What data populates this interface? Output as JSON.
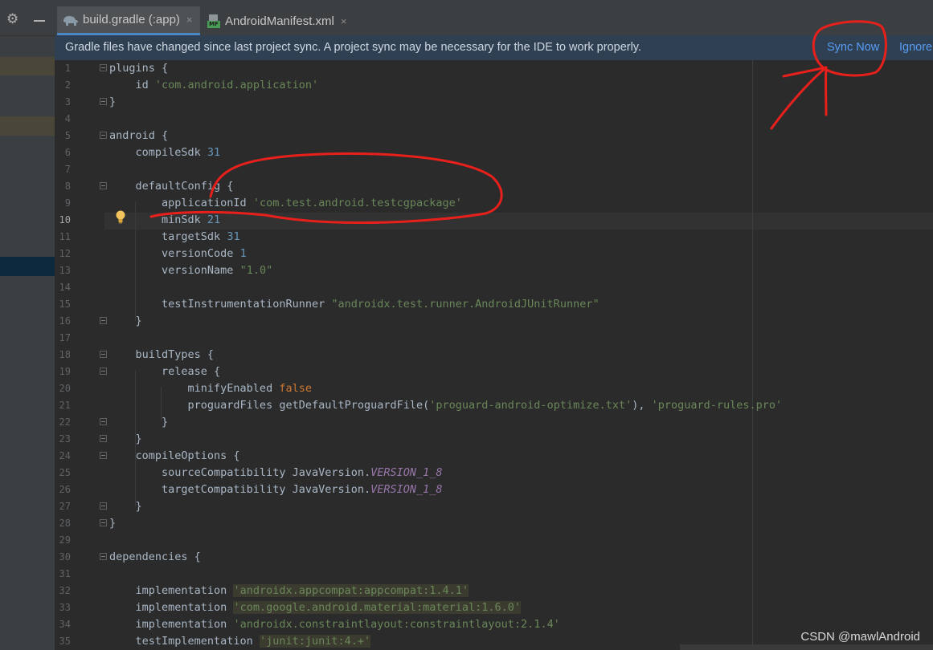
{
  "toolbar": {
    "gear_icon": "gear-icon",
    "minimize_icon": "minus-icon"
  },
  "tabs": [
    {
      "label": "build.gradle (:app)",
      "icon": "gradle-elephant-icon",
      "close": "×",
      "active": true
    },
    {
      "label": "AndroidManifest.xml",
      "icon": "manifest-file-icon",
      "icon_text": "MF",
      "close": "×",
      "active": false
    }
  ],
  "banner": {
    "message": "Gradle files have changed since last project sync. A project sync may be necessary for the IDE to work properly.",
    "sync_now": "Sync Now",
    "ignore": "Ignore"
  },
  "editor": {
    "current_line": 10,
    "lines": [
      {
        "n": "1",
        "tokens": [
          [
            "plugins {",
            "p"
          ]
        ]
      },
      {
        "n": "2",
        "tokens": [
          [
            "    id ",
            "p"
          ],
          [
            "'com.android.application'",
            "s"
          ]
        ]
      },
      {
        "n": "3",
        "tokens": [
          [
            "}",
            "p"
          ]
        ]
      },
      {
        "n": "4",
        "tokens": []
      },
      {
        "n": "5",
        "tokens": [
          [
            "android {",
            "p"
          ]
        ]
      },
      {
        "n": "6",
        "tokens": [
          [
            "    compileSdk ",
            "p"
          ],
          [
            "31",
            "n"
          ]
        ]
      },
      {
        "n": "7",
        "tokens": []
      },
      {
        "n": "8",
        "tokens": [
          [
            "    defaultConfig {",
            "p"
          ]
        ]
      },
      {
        "n": "9",
        "tokens": [
          [
            "        applicationId ",
            "p"
          ],
          [
            "'com.test.android.testcgpackage'",
            "s"
          ]
        ]
      },
      {
        "n": "10",
        "tokens": [
          [
            "        minSdk ",
            "p"
          ],
          [
            "21",
            "n"
          ]
        ]
      },
      {
        "n": "11",
        "tokens": [
          [
            "        targetSdk ",
            "p"
          ],
          [
            "31",
            "n"
          ]
        ]
      },
      {
        "n": "12",
        "tokens": [
          [
            "        versionCode ",
            "p"
          ],
          [
            "1",
            "n"
          ]
        ]
      },
      {
        "n": "13",
        "tokens": [
          [
            "        versionName ",
            "p"
          ],
          [
            "\"1.0\"",
            "s"
          ]
        ]
      },
      {
        "n": "14",
        "tokens": []
      },
      {
        "n": "15",
        "tokens": [
          [
            "        testInstrumentationRunner ",
            "p"
          ],
          [
            "\"androidx.test.runner.AndroidJUnitRunner\"",
            "s"
          ]
        ]
      },
      {
        "n": "16",
        "tokens": [
          [
            "    }",
            "p"
          ]
        ]
      },
      {
        "n": "17",
        "tokens": []
      },
      {
        "n": "18",
        "tokens": [
          [
            "    buildTypes {",
            "p"
          ]
        ]
      },
      {
        "n": "19",
        "tokens": [
          [
            "        release {",
            "p"
          ]
        ]
      },
      {
        "n": "20",
        "tokens": [
          [
            "            minifyEnabled ",
            "p"
          ],
          [
            "false",
            "k"
          ]
        ]
      },
      {
        "n": "21",
        "tokens": [
          [
            "            proguardFiles getDefaultProguardFile(",
            "p"
          ],
          [
            "'proguard-android-optimize.txt'",
            "s"
          ],
          [
            "), ",
            "p"
          ],
          [
            "'proguard-rules.pro'",
            "s"
          ]
        ]
      },
      {
        "n": "22",
        "tokens": [
          [
            "        }",
            "p"
          ]
        ]
      },
      {
        "n": "23",
        "tokens": [
          [
            "    }",
            "p"
          ]
        ]
      },
      {
        "n": "24",
        "tokens": [
          [
            "    compileOptions {",
            "p"
          ]
        ]
      },
      {
        "n": "25",
        "tokens": [
          [
            "        sourceCompatibility JavaVersion.",
            "p"
          ],
          [
            "VERSION_1_8",
            "c"
          ]
        ]
      },
      {
        "n": "26",
        "tokens": [
          [
            "        targetCompatibility JavaVersion.",
            "p"
          ],
          [
            "VERSION_1_8",
            "c"
          ]
        ]
      },
      {
        "n": "27",
        "tokens": [
          [
            "    }",
            "p"
          ]
        ]
      },
      {
        "n": "28",
        "tokens": [
          [
            "}",
            "p"
          ]
        ]
      },
      {
        "n": "29",
        "tokens": []
      },
      {
        "n": "30",
        "tokens": [
          [
            "dependencies {",
            "p"
          ]
        ]
      },
      {
        "n": "31",
        "tokens": []
      },
      {
        "n": "32",
        "tokens": [
          [
            "    implementation ",
            "p"
          ],
          [
            "'androidx.appcompat:appcompat:1.4.1'",
            "sh"
          ]
        ]
      },
      {
        "n": "33",
        "tokens": [
          [
            "    implementation ",
            "p"
          ],
          [
            "'com.google.android.material:material:1.6.0'",
            "sh"
          ]
        ]
      },
      {
        "n": "34",
        "tokens": [
          [
            "    implementation ",
            "p"
          ],
          [
            "'androidx.constraintlayout:constraintlayout:2.1.4'",
            "s"
          ]
        ]
      },
      {
        "n": "35",
        "tokens": [
          [
            "    testImplementation ",
            "p"
          ],
          [
            "'junit:junit:4.+'",
            "sh"
          ]
        ]
      }
    ]
  },
  "watermark": "CSDN @mawlAndroid",
  "colors": {
    "plain": "#a9b7c6",
    "string": "#6a8759",
    "number": "#6897bb",
    "keyword": "#cc7832",
    "constant": "#9876aa",
    "string_highlight_bg": "#3b3b2f",
    "link": "#589df6",
    "annotation": "#e8201c"
  }
}
